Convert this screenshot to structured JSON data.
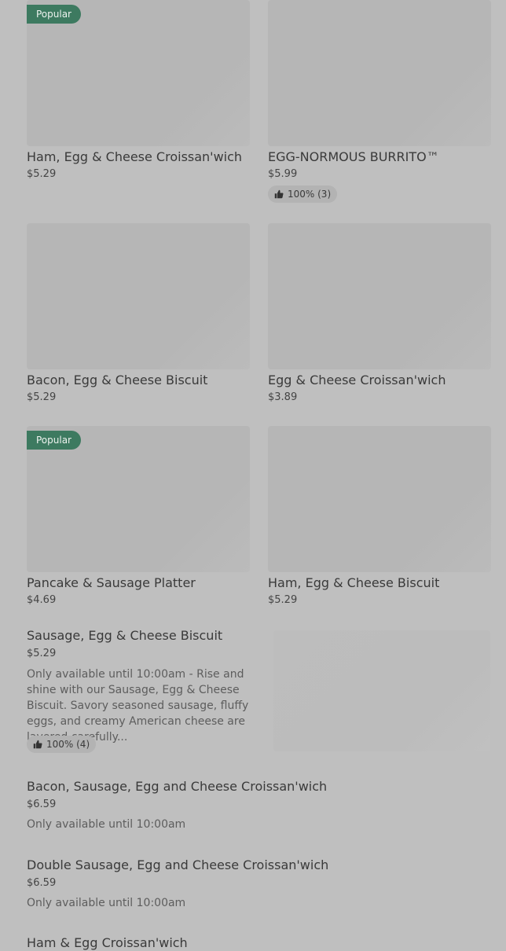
{
  "grid": [
    {
      "name": "Ham, Egg & Cheese Croissan'wich",
      "price": "$5.29",
      "badge": "Popular",
      "rating": ""
    },
    {
      "name": "EGG-NORMOUS BURRITO™",
      "price": "$5.99",
      "badge": "",
      "rating": "100% (3)"
    },
    {
      "name": "Bacon, Egg & Cheese Biscuit",
      "price": "$5.29",
      "badge": "",
      "rating": ""
    },
    {
      "name": "Egg & Cheese Croissan'wich",
      "price": "$3.89",
      "badge": "",
      "rating": ""
    },
    {
      "name": "Pancake & Sausage Platter",
      "price": "$4.69",
      "badge": "Popular",
      "rating": ""
    },
    {
      "name": "Ham, Egg & Cheese Biscuit",
      "price": "$5.29",
      "badge": "",
      "rating": ""
    }
  ],
  "list": [
    {
      "name": "Sausage, Egg & Cheese Biscuit",
      "price": "$5.29",
      "description": "Only available until 10:00am - Rise and shine with our Sausage, Egg & Cheese Biscuit. Savory seasoned sausage, fluffy eggs, and creamy American cheese are layered carefully...",
      "rating": "100% (4)"
    },
    {
      "name": "Bacon, Sausage, Egg and Cheese Croissan'wich",
      "price": "$6.59",
      "availability": "Only available until 10:00am"
    },
    {
      "name": "Double Sausage, Egg and Cheese Croissan'wich",
      "price": "$6.59",
      "availability": "Only available until 10:00am"
    },
    {
      "name": "Ham & Egg Croissan'wich"
    }
  ],
  "icons": {
    "rating": "thumbs-up-icon"
  },
  "colors": {
    "badge_bg": "#3d7a60",
    "background": "#bfbfbf"
  }
}
